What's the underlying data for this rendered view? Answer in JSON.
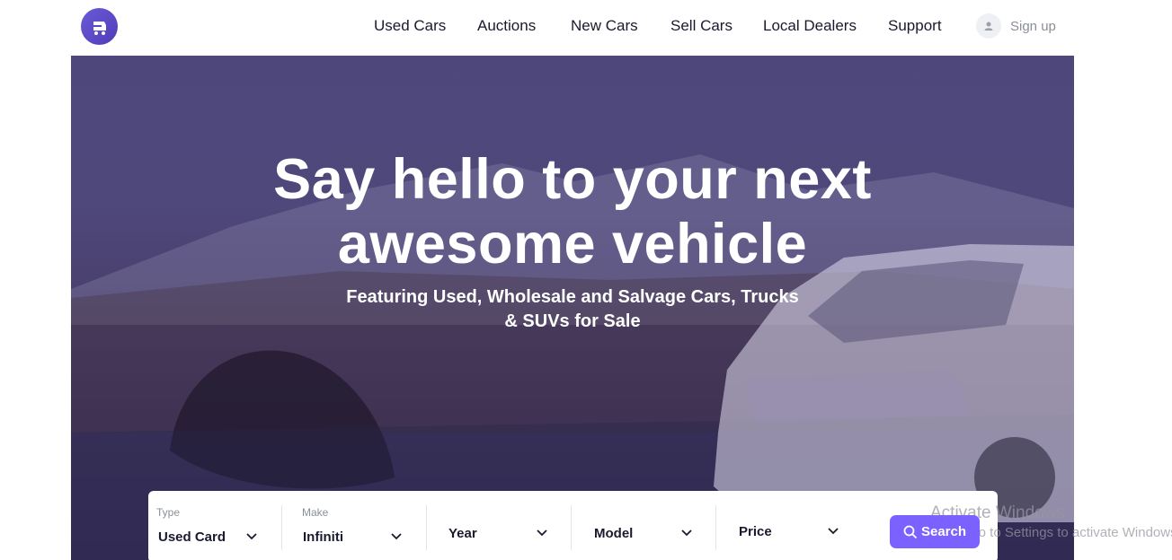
{
  "brand": {
    "logo_icon": "cart-icon",
    "accent": "#7b61ff"
  },
  "nav": {
    "items": [
      {
        "label": "Used Cars"
      },
      {
        "label": "Auctions"
      },
      {
        "label": "New Cars"
      },
      {
        "label": "Sell Cars"
      },
      {
        "label": "Local Dealers"
      },
      {
        "label": "Support"
      }
    ],
    "signup_label": "Sign up",
    "signup_icon": "user-icon"
  },
  "hero": {
    "title_line1": "Say hello to your next",
    "title_line2": "awesome vehicle",
    "subtitle_line1": "Featuring Used, Wholesale and Salvage Cars, Trucks",
    "subtitle_line2": "& SUVs for Sale"
  },
  "search": {
    "fields": [
      {
        "label": "Type",
        "value": "Used Card"
      },
      {
        "label": "Make",
        "value": "Infiniti"
      },
      {
        "label": "",
        "value": "Year"
      },
      {
        "label": "",
        "value": "Model"
      },
      {
        "label": "",
        "value": "Price"
      }
    ],
    "button_label": "Search"
  },
  "watermark": {
    "line1": "Activate Windows",
    "line2": "Go to Settings to activate Windows."
  }
}
